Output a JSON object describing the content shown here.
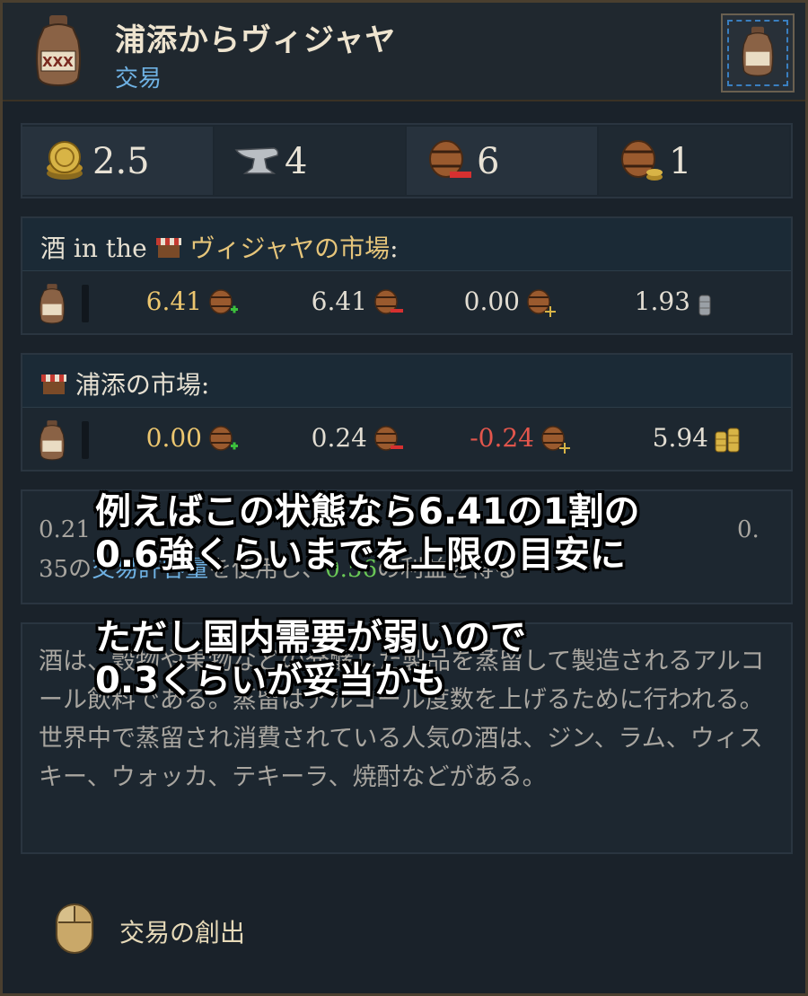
{
  "header": {
    "title": "浦添からヴィジャヤ",
    "subtitle": "交易",
    "icon": "liquor-jug-icon",
    "jug_label": "XXX"
  },
  "stats": [
    {
      "icon": "gold-coins-icon",
      "value": "2.5"
    },
    {
      "icon": "anvil-icon",
      "value": "4"
    },
    {
      "icon": "barrel-minus-icon",
      "value": "6"
    },
    {
      "icon": "barrel-coins-icon",
      "value": "1"
    }
  ],
  "markets": [
    {
      "title_prefix": "酒 in the",
      "title_market": "ヴィジャヤの市場",
      "title_suffix": ":",
      "cells": [
        {
          "value": "6.41",
          "icon": "barrel-plus-icon",
          "tone": "gold"
        },
        {
          "value": "6.41",
          "icon": "barrel-minus-icon",
          "tone": "white"
        },
        {
          "value": "0.00",
          "icon": "barrel-scale-icon",
          "tone": "white"
        },
        {
          "value": "1.93",
          "icon": "silver-coin-icon",
          "tone": "white"
        }
      ]
    },
    {
      "title_prefix": "",
      "title_market": "浦添の市場",
      "title_suffix": ":",
      "cells": [
        {
          "value": "0.00",
          "icon": "barrel-plus-icon",
          "tone": "gold"
        },
        {
          "value": "0.24",
          "icon": "barrel-minus-icon",
          "tone": "white"
        },
        {
          "value": "-0.24",
          "icon": "barrel-scale-icon",
          "tone": "red"
        },
        {
          "value": "5.94",
          "icon": "gold-coin-stack-icon",
          "tone": "white"
        }
      ]
    }
  ],
  "trade_text": {
    "line1_start": "0.21",
    "line1_end": "0.",
    "line2_start": "35の",
    "line2_mid1": "交易許容量",
    "line2_mid2": "を使用し、",
    "line2_green": "0.56",
    "line2_end": "の利益を得る"
  },
  "description": "酒は、穀物や果物などの発酵した製品を蒸留して製造されるアルコール飲料である。蒸留はアルコール度数を上げるために行われる。世界中で蒸留され消費されている人気の酒は、ジン、ラム、ウィスキー、ウォッカ、テキーラ、焼酎などがある。",
  "overlay": {
    "line1": "例えばこの状態なら6.41の1割の",
    "line2": "0.6強くらいまでを上限の目安に",
    "line3": "ただし国内需要が弱いので",
    "line4": "0.3くらいが妥当かも"
  },
  "footer": {
    "icon": "mouse-icon",
    "label": "交易の創出"
  },
  "colors": {
    "gold": "#ecc66f",
    "red": "#e3564c",
    "green": "#6ac857",
    "link_blue": "#6fb2e4"
  }
}
